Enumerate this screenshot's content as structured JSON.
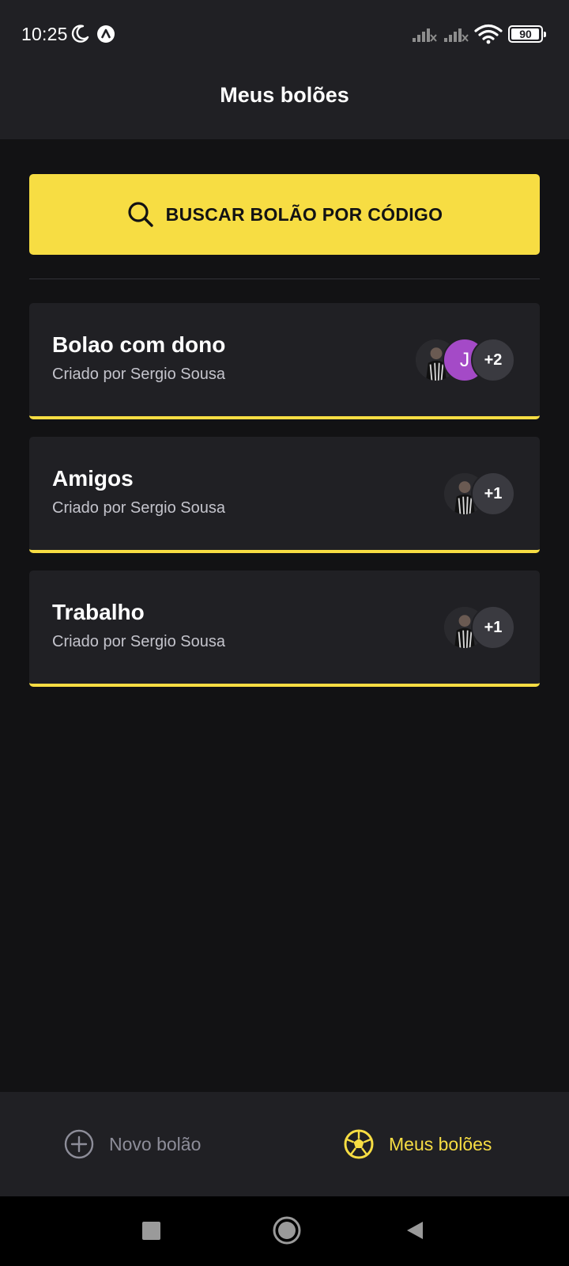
{
  "status_bar": {
    "time": "10:25",
    "battery": "90",
    "icons": [
      "moon-icon",
      "notification-a-icon",
      "signal-icon",
      "signal-icon",
      "wifi-icon",
      "battery-icon"
    ]
  },
  "header": {
    "title": "Meus bolões"
  },
  "search": {
    "label": "BUSCAR BOLÃO POR CÓDIGO",
    "icon": "search-icon"
  },
  "pools": [
    {
      "name": "Bolao com dono",
      "owner": "Criado por Sergio Sousa",
      "avatars": [
        {
          "type": "photo"
        },
        {
          "type": "letter",
          "text": "J"
        },
        {
          "type": "count",
          "text": "+2"
        }
      ]
    },
    {
      "name": "Amigos",
      "owner": "Criado por Sergio Sousa",
      "avatars": [
        {
          "type": "photo"
        },
        {
          "type": "count",
          "text": "+1"
        }
      ]
    },
    {
      "name": "Trabalho",
      "owner": "Criado por Sergio Sousa",
      "avatars": [
        {
          "type": "photo"
        },
        {
          "type": "count",
          "text": "+1"
        }
      ]
    }
  ],
  "bottom_nav": {
    "new_label": "Novo bolão",
    "mine_label": "Meus bolões"
  },
  "colors": {
    "accent": "#F7DD43",
    "background": "#121214",
    "surface": "#202024",
    "avatar_letter": "#A44AC7"
  }
}
